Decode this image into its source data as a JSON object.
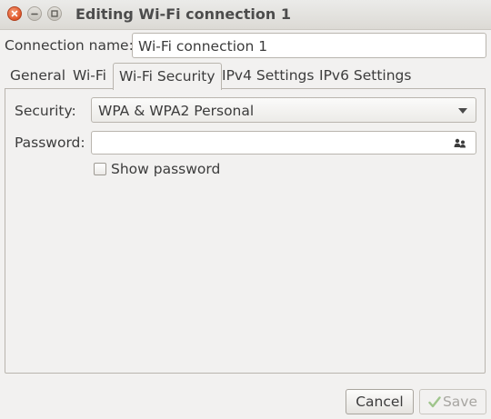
{
  "window": {
    "title": "Editing Wi-Fi connection 1",
    "controls": [
      "close-icon",
      "minimize-icon",
      "maximize-icon"
    ]
  },
  "connection": {
    "label": "Connection name:",
    "value": "Wi-Fi connection 1"
  },
  "tabs": [
    {
      "label": "General",
      "active": false
    },
    {
      "label": "Wi-Fi",
      "active": false
    },
    {
      "label": "Wi-Fi Security",
      "active": true
    },
    {
      "label": "IPv4 Settings",
      "active": false
    },
    {
      "label": "IPv6 Settings",
      "active": false
    }
  ],
  "security": {
    "label": "Security:",
    "selected": "WPA & WPA2 Personal"
  },
  "password": {
    "label": "Password:",
    "value": "",
    "icon": "users-icon"
  },
  "show_password": {
    "label": "Show password",
    "checked": false
  },
  "buttons": {
    "cancel": "Cancel",
    "save": "Save",
    "save_enabled": false
  },
  "colors": {
    "close_button": "#e0572a",
    "background": "#f2f1f0"
  }
}
